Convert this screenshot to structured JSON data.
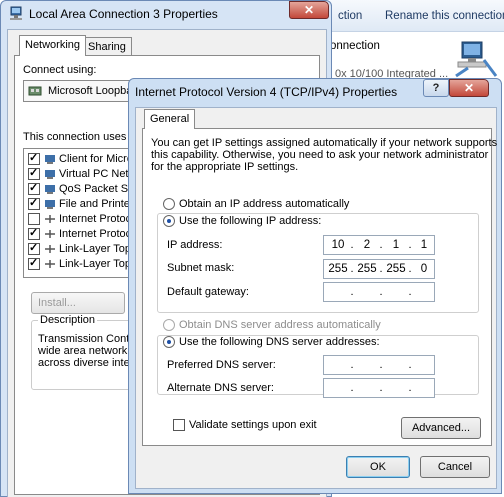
{
  "background_window": {
    "toolbar": {
      "action_connection": "ction",
      "action_rename": "Rename this connection"
    },
    "item": {
      "name": "onnection",
      "device": "0x 10/100 Integrated ..."
    }
  },
  "left_dialog": {
    "title": "Local Area Connection 3 Properties",
    "close": "✕",
    "tabs": [
      "Networking",
      "Sharing"
    ],
    "connect_using_label": "Connect using:",
    "adapter_name": "Microsoft Loopba",
    "uses_items_label": "This connection uses th",
    "components": [
      {
        "label": "Client for Micro",
        "checked": true
      },
      {
        "label": "Virtual PC Netw",
        "checked": true
      },
      {
        "label": "QoS Packet Sc",
        "checked": true
      },
      {
        "label": "File and Printer",
        "checked": true
      },
      {
        "label": "Internet Protoc",
        "checked": false
      },
      {
        "label": "Internet Protoc",
        "checked": true
      },
      {
        "label": "Link-Layer Top",
        "checked": true
      },
      {
        "label": "Link-Layer Top",
        "checked": true
      }
    ],
    "install_button": "Install...",
    "description_title": "Description",
    "description_lines": [
      "Transmission Control",
      "wide area network pr",
      "across diverse interc"
    ]
  },
  "front_dialog": {
    "title": "Internet Protocol Version 4 (TCP/IPv4) Properties",
    "help": "?",
    "close": "✕",
    "tab": "General",
    "intro_lines": [
      "You can get IP settings assigned automatically if your network supports",
      "this capability. Otherwise, you need to ask your network administrator",
      "for the appropriate IP settings."
    ],
    "ip_auto_label": "Obtain an IP address automatically",
    "ip_manual_label": "Use the following IP address:",
    "ip_address_label": "IP address:",
    "ip_address": [
      "10",
      "2",
      "1",
      "1"
    ],
    "subnet_label": "Subnet mask:",
    "subnet": [
      "255",
      "255",
      "255",
      "0"
    ],
    "gateway_label": "Default gateway:",
    "gateway": [
      "",
      "",
      "",
      ""
    ],
    "dns_auto_label": "Obtain DNS server address automatically",
    "dns_manual_label": "Use the following DNS server addresses:",
    "preferred_dns_label": "Preferred DNS server:",
    "preferred_dns": [
      "",
      "",
      "",
      ""
    ],
    "alternate_dns_label": "Alternate DNS server:",
    "alternate_dns": [
      "",
      "",
      "",
      ""
    ],
    "validate_label": "Validate settings upon exit",
    "validate_checked": false,
    "advanced_button": "Advanced...",
    "ok_button": "OK",
    "cancel_button": "Cancel",
    "selected_ip_mode": "manual",
    "selected_dns_mode": "manual"
  },
  "colors": {
    "accent": "#1d4fa5",
    "titlebar": "#cfdff2",
    "close_button": "#c3483a"
  }
}
